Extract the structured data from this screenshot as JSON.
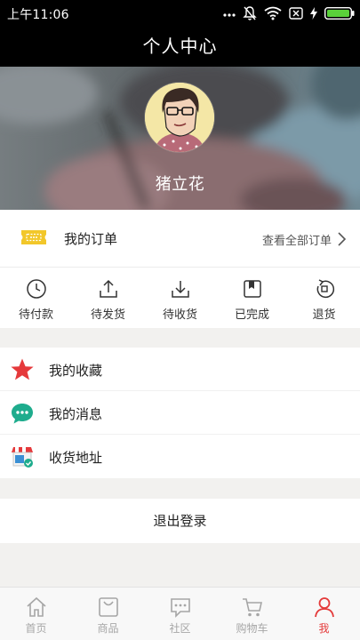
{
  "status_bar": {
    "time": "上午11:06",
    "icons": [
      "notification-dots-icon",
      "silent-bell-icon",
      "wifi-icon",
      "sim-blocked-icon",
      "charging-icon",
      "battery-icon"
    ]
  },
  "header": {
    "title": "个人中心"
  },
  "profile": {
    "avatar_icon": "avatar-illustration",
    "name": "猪立花"
  },
  "orders": {
    "title": "我的订单",
    "view_all": "查看全部订单",
    "icon": "ticket-icon",
    "statuses": [
      {
        "label": "待付款",
        "icon": "clock-icon"
      },
      {
        "label": "待发货",
        "icon": "upload-icon"
      },
      {
        "label": "待收货",
        "icon": "download-icon"
      },
      {
        "label": "已完成",
        "icon": "bookmark-icon"
      },
      {
        "label": "退货",
        "icon": "return-icon"
      }
    ]
  },
  "menu": {
    "items": [
      {
        "label": "我的收藏",
        "icon": "star-icon",
        "color": "#e5393b"
      },
      {
        "label": "我的消息",
        "icon": "chat-bubble-icon",
        "color": "#1eac8d"
      },
      {
        "label": "收货地址",
        "icon": "storefront-icon",
        "color": "#3a8fd4"
      }
    ]
  },
  "logout": {
    "label": "退出登录"
  },
  "bottom_nav": {
    "items": [
      {
        "label": "首页",
        "icon": "home-icon",
        "active": false
      },
      {
        "label": "商品",
        "icon": "shopping-bag-icon",
        "active": false
      },
      {
        "label": "社区",
        "icon": "community-chat-icon",
        "active": false
      },
      {
        "label": "购物车",
        "icon": "cart-icon",
        "active": false
      },
      {
        "label": "我",
        "icon": "person-icon",
        "active": true
      }
    ],
    "active_color": "#e43a3a",
    "inactive_color": "#a6a6a6"
  }
}
